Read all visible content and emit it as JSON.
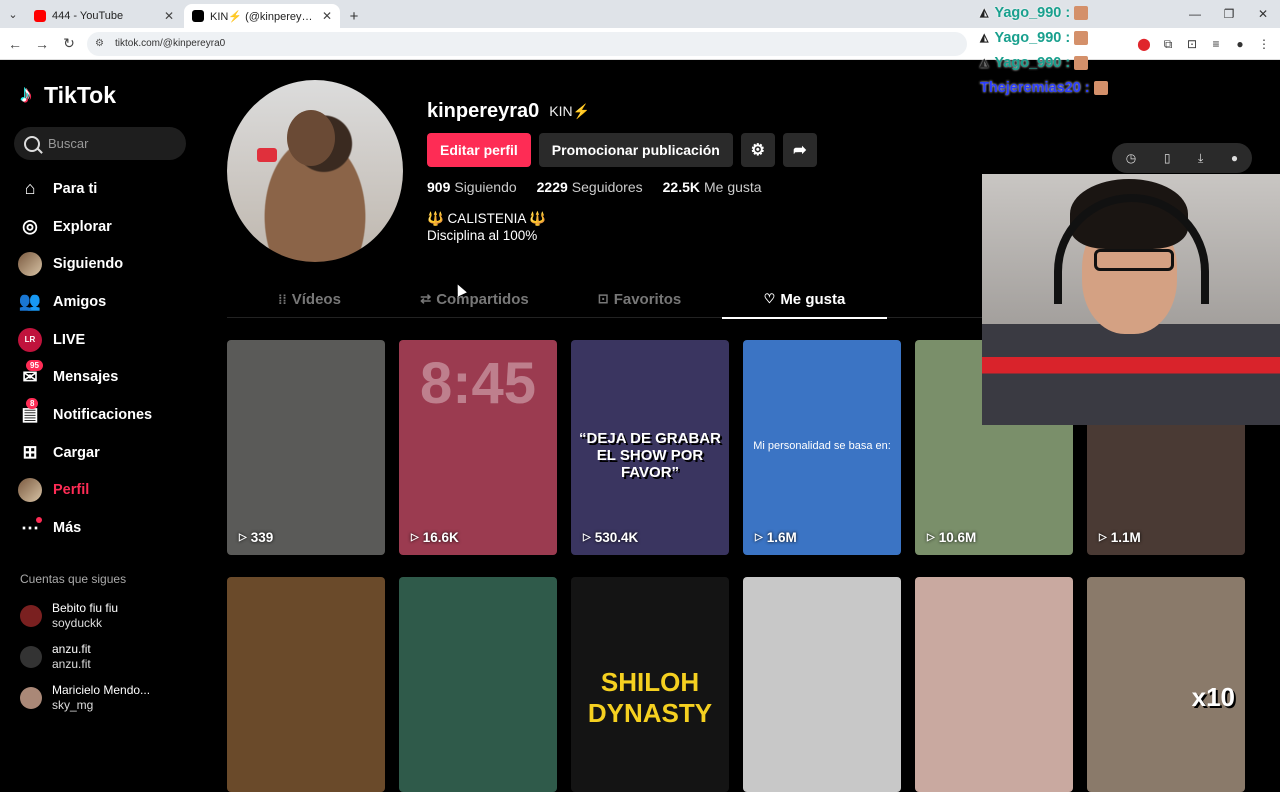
{
  "browser": {
    "tabs": [
      {
        "title": "444 - YouTube",
        "active": false
      },
      {
        "title": "KIN⚡️ (@kinpereyra0) | TikTok",
        "active": true
      }
    ],
    "new_tab": "+",
    "url": "tiktok.com/@kinpereyra0"
  },
  "sidebar": {
    "logo": "TikTok",
    "search_placeholder": "Buscar",
    "items": [
      {
        "label": "Para ti",
        "icon": "home-icon",
        "glyph": "⌂"
      },
      {
        "label": "Explorar",
        "icon": "compass-icon",
        "glyph": "◎"
      },
      {
        "label": "Siguiendo",
        "icon": "following-avatar-icon",
        "glyph": ""
      },
      {
        "label": "Amigos",
        "icon": "friends-icon",
        "glyph": "👥"
      },
      {
        "label": "LIVE",
        "icon": "live-icon",
        "glyph": "LR"
      },
      {
        "label": "Mensajes",
        "icon": "messages-icon",
        "glyph": "✉",
        "badge": "95"
      },
      {
        "label": "Notificaciones",
        "icon": "notifications-icon",
        "glyph": "▤",
        "badge": "8"
      },
      {
        "label": "Cargar",
        "icon": "upload-icon",
        "glyph": "⊞"
      },
      {
        "label": "Perfil",
        "icon": "profile-avatar-icon",
        "glyph": ""
      },
      {
        "label": "Más",
        "icon": "more-icon",
        "glyph": "⋯"
      }
    ],
    "following_heading": "Cuentas que sigues",
    "following": [
      {
        "name": "Bebito fiu fiu",
        "user": "soyduckk"
      },
      {
        "name": "anzu.fit",
        "user": "anzu.fit"
      },
      {
        "name": "Maricielo Mendo...",
        "user": "sky_mg"
      }
    ]
  },
  "profile": {
    "username": "kinpereyra0",
    "nickname": "KIN⚡️",
    "edit_button": "Editar perfil",
    "promote_button": "Promocionar publicación",
    "stats": [
      {
        "num": "909",
        "label": "Siguiendo"
      },
      {
        "num": "2229",
        "label": "Seguidores"
      },
      {
        "num": "22.5K",
        "label": "Me gusta"
      }
    ],
    "bio_line1": "🔱 CALISTENIA 🔱",
    "bio_line2": "Disciplina al 100%",
    "tabs": [
      {
        "label": "Vídeos",
        "glyph": "⁞⁞"
      },
      {
        "label": "Compartidos",
        "glyph": "⇄"
      },
      {
        "label": "Favoritos",
        "glyph": "⊡"
      },
      {
        "label": "Me gusta",
        "glyph": "♡"
      }
    ]
  },
  "videos": [
    {
      "views": "339",
      "caption": "",
      "bg": "#5a5a58"
    },
    {
      "views": "16.6K",
      "caption": "8:45",
      "bg": "#9b3b50"
    },
    {
      "views": "530.4K",
      "caption": "“DEJA DE GRABAR EL SHOW POR FAVOR”",
      "bg": "#3a3560"
    },
    {
      "views": "1.6M",
      "caption": "Mi personalidad se basa en:",
      "bg": "#3b74c4"
    },
    {
      "views": "10.6M",
      "caption": "",
      "bg": "#7a8f6a"
    },
    {
      "views": "1.1M",
      "caption": "",
      "bg": "#4a3a34"
    },
    {
      "views": "",
      "caption": "",
      "bg": "#6a4a2a"
    },
    {
      "views": "",
      "caption": "",
      "bg": "#2f5a4a"
    },
    {
      "views": "",
      "caption": "SHILOH DYNASTY",
      "bg": "#141414"
    },
    {
      "views": "",
      "caption": "",
      "bg": "#c8c8c8"
    },
    {
      "views": "",
      "caption": "",
      "bg": "#c9a9a0"
    },
    {
      "views": "",
      "caption": "x10",
      "bg": "#8a7a6a"
    }
  ],
  "stream": {
    "chat": [
      {
        "user": "Yago_990 :",
        "blue": false
      },
      {
        "user": "Yago_990 :",
        "blue": false
      },
      {
        "user": "Yago_990 :",
        "blue": false
      },
      {
        "user": "Thejeremias20 :",
        "blue": true
      }
    ]
  }
}
